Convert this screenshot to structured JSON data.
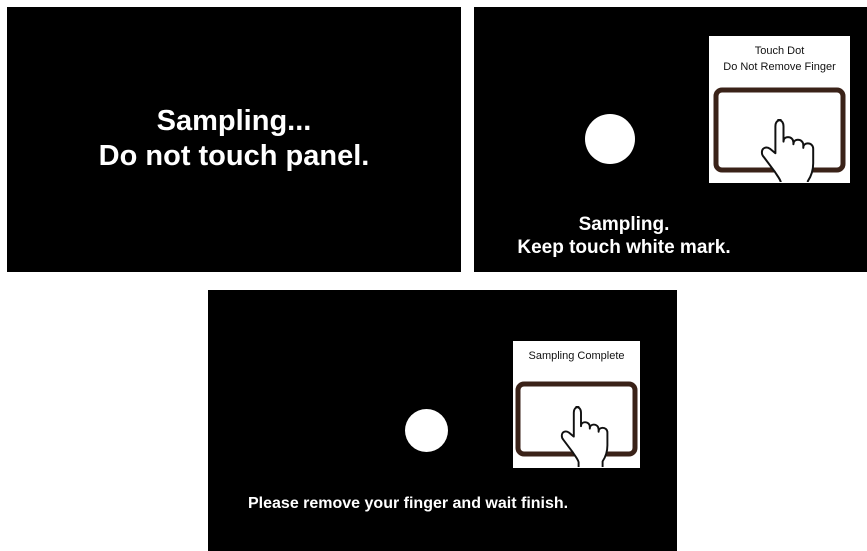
{
  "screens": {
    "pre_sampling": {
      "message_lines": [
        "Sampling...",
        "Do not touch panel."
      ]
    },
    "touch_sampling": {
      "message_lines": [
        "Sampling.",
        "Keep touch white mark."
      ],
      "card_lines": [
        "Touch Dot",
        "Do Not Remove Finger"
      ]
    },
    "sampling_complete": {
      "message": "Please remove your finger and wait finish.",
      "card_lines": [
        "Sampling Complete"
      ]
    }
  },
  "colors": {
    "screen_bg": "#000000",
    "text": "#ffffff",
    "tablet_frame": "#3a2218"
  },
  "icons": [
    "touch-dot",
    "tablet-icon",
    "finger-touch-icon"
  ]
}
